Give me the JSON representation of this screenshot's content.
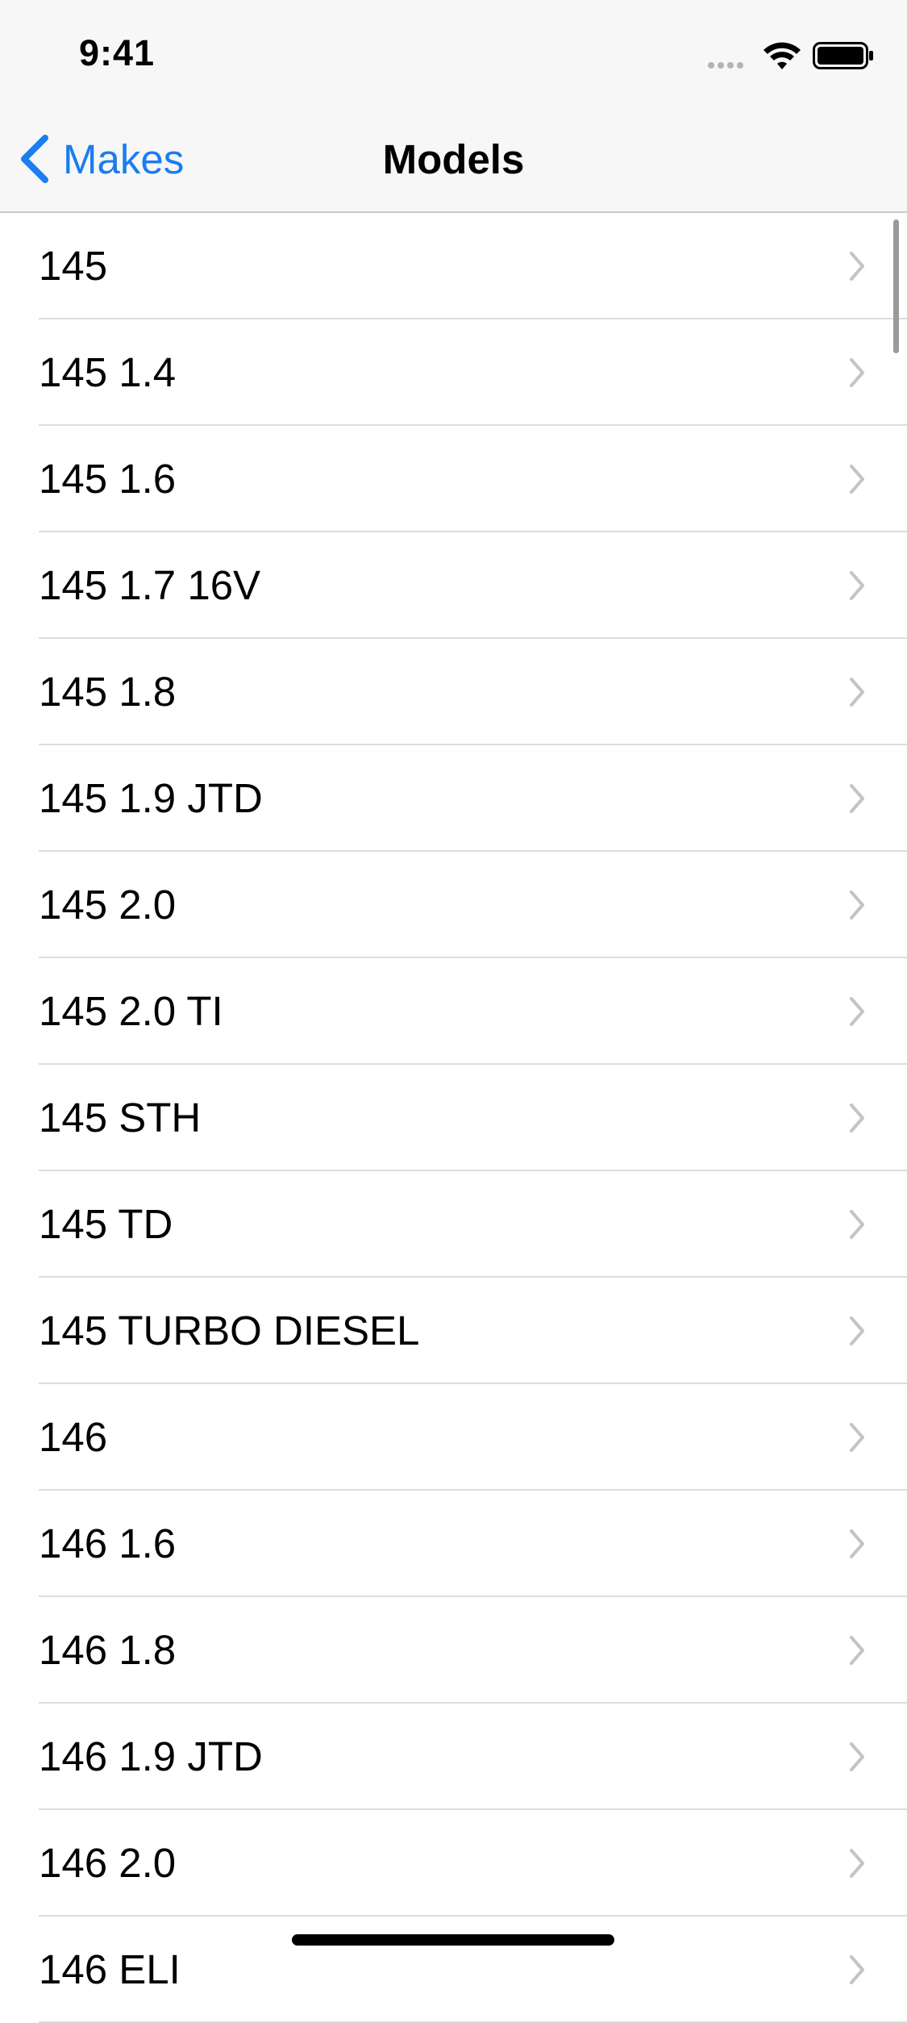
{
  "status": {
    "time": "9:41"
  },
  "nav": {
    "back_label": "Makes",
    "title": "Models"
  },
  "models": [
    "145",
    "145 1.4",
    "145 1.6",
    "145 1.7 16V",
    "145 1.8",
    "145 1.9 JTD",
    "145 2.0",
    "145 2.0 TI",
    "145 STH",
    "145 TD",
    "145 TURBO DIESEL",
    "146",
    "146 1.6",
    "146 1.8",
    "146 1.9 JTD",
    "146 2.0",
    "146 ELI"
  ],
  "colors": {
    "accent": "#1a7df0",
    "chevron": "#c4c4c7"
  }
}
